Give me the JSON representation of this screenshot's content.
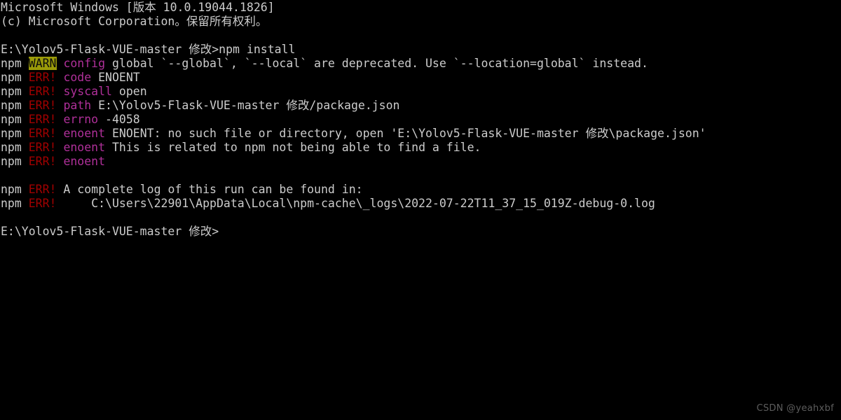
{
  "window": {
    "title": "Command Prompt",
    "background_color": "#000000",
    "foreground_color": "#cccccc"
  },
  "colors": {
    "default": "#cccccc",
    "error": "#a00000",
    "magenta": "#b0309a",
    "warn_background": "#9b9b09",
    "warn_foreground": "#0c0c0c",
    "watermark": "#5d5d5d"
  },
  "terminal": {
    "lines": [
      {
        "id": "line-version-banner",
        "segments": [
          {
            "style": "default",
            "text": "Microsoft Windows [版本 10.0.19044.1826]"
          }
        ]
      },
      {
        "id": "line-copyright",
        "segments": [
          {
            "style": "default",
            "text": "(c) Microsoft Corporation。保留所有权利。"
          }
        ]
      },
      {
        "id": "line-blank-1",
        "segments": []
      },
      {
        "id": "line-prompt-command",
        "segments": [
          {
            "style": "default",
            "text": "E:\\Yolov5-Flask-VUE-master 修改>npm install"
          }
        ]
      },
      {
        "id": "line-npm-warn-config",
        "segments": [
          {
            "style": "default",
            "text": "npm "
          },
          {
            "style": "warn",
            "text": "WARN"
          },
          {
            "style": "default",
            "text": " "
          },
          {
            "style": "magenta",
            "text": "config"
          },
          {
            "style": "default",
            "text": " global `--global`, `--local` are deprecated. Use `--location=global` instead."
          }
        ]
      },
      {
        "id": "line-npm-err-code",
        "segments": [
          {
            "style": "default",
            "text": "npm "
          },
          {
            "style": "err",
            "text": "ERR!"
          },
          {
            "style": "default",
            "text": " "
          },
          {
            "style": "magenta",
            "text": "code"
          },
          {
            "style": "default",
            "text": " ENOENT"
          }
        ]
      },
      {
        "id": "line-npm-err-syscall",
        "segments": [
          {
            "style": "default",
            "text": "npm "
          },
          {
            "style": "err",
            "text": "ERR!"
          },
          {
            "style": "default",
            "text": " "
          },
          {
            "style": "magenta",
            "text": "syscall"
          },
          {
            "style": "default",
            "text": " open"
          }
        ]
      },
      {
        "id": "line-npm-err-path",
        "segments": [
          {
            "style": "default",
            "text": "npm "
          },
          {
            "style": "err",
            "text": "ERR!"
          },
          {
            "style": "default",
            "text": " "
          },
          {
            "style": "magenta",
            "text": "path"
          },
          {
            "style": "default",
            "text": " E:\\Yolov5-Flask-VUE-master 修改/package.json"
          }
        ]
      },
      {
        "id": "line-npm-err-errno",
        "segments": [
          {
            "style": "default",
            "text": "npm "
          },
          {
            "style": "err",
            "text": "ERR!"
          },
          {
            "style": "default",
            "text": " "
          },
          {
            "style": "magenta",
            "text": "errno"
          },
          {
            "style": "default",
            "text": " -4058"
          }
        ]
      },
      {
        "id": "line-npm-err-enoent-1",
        "segments": [
          {
            "style": "default",
            "text": "npm "
          },
          {
            "style": "err",
            "text": "ERR!"
          },
          {
            "style": "default",
            "text": " "
          },
          {
            "style": "magenta",
            "text": "enoent"
          },
          {
            "style": "default",
            "text": " ENOENT: no such file or directory, open 'E:\\Yolov5-Flask-VUE-master 修改\\package.json'"
          }
        ]
      },
      {
        "id": "line-npm-err-enoent-2",
        "segments": [
          {
            "style": "default",
            "text": "npm "
          },
          {
            "style": "err",
            "text": "ERR!"
          },
          {
            "style": "default",
            "text": " "
          },
          {
            "style": "magenta",
            "text": "enoent"
          },
          {
            "style": "default",
            "text": " This is related to npm not being able to find a file."
          }
        ]
      },
      {
        "id": "line-npm-err-enoent-3",
        "segments": [
          {
            "style": "default",
            "text": "npm "
          },
          {
            "style": "err",
            "text": "ERR!"
          },
          {
            "style": "default",
            "text": " "
          },
          {
            "style": "magenta",
            "text": "enoent"
          }
        ]
      },
      {
        "id": "line-blank-2",
        "segments": []
      },
      {
        "id": "line-npm-err-log-intro",
        "segments": [
          {
            "style": "default",
            "text": "npm "
          },
          {
            "style": "err",
            "text": "ERR!"
          },
          {
            "style": "default",
            "text": " A complete log of this run can be found in:"
          }
        ]
      },
      {
        "id": "line-npm-err-log-path",
        "segments": [
          {
            "style": "default",
            "text": "npm "
          },
          {
            "style": "err",
            "text": "ERR!"
          },
          {
            "style": "default",
            "text": "     C:\\Users\\22901\\AppData\\Local\\npm-cache\\_logs\\2022-07-22T11_37_15_019Z-debug-0.log"
          }
        ]
      },
      {
        "id": "line-blank-3",
        "segments": []
      },
      {
        "id": "line-final-prompt",
        "segments": [
          {
            "style": "default",
            "text": "E:\\Yolov5-Flask-VUE-master 修改>"
          }
        ]
      }
    ]
  },
  "watermark": {
    "text": "CSDN @yeahxbf"
  }
}
